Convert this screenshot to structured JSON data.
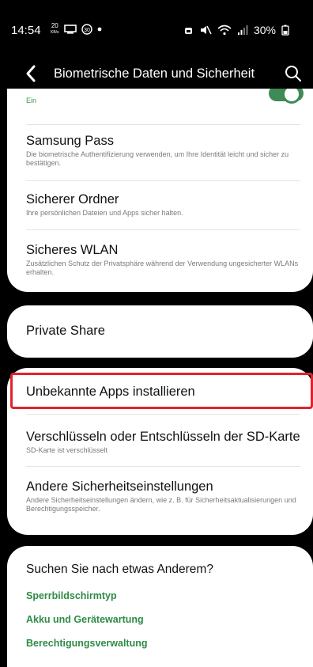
{
  "status_bar": {
    "time": "14:54",
    "speed_value": "20",
    "speed_unit": "KB/s",
    "battery_text": "30%"
  },
  "header": {
    "title": "Biometrische Daten und Sicherheit"
  },
  "card1": {
    "toggle_label": "Ein",
    "toggle_on": true,
    "items": [
      {
        "title": "Samsung Pass",
        "subtitle": "Die biometrische Authentifizierung verwenden, um Ihre Identität leicht und sicher zu bestätigen."
      },
      {
        "title": "Sicherer Ordner",
        "subtitle": "Ihre persönlichen Dateien und Apps sicher halten."
      },
      {
        "title": "Sicheres WLAN",
        "subtitle": "Zusätzlichen Schutz der Privatsphäre während der Verwendung ungesicherter WLANs erhalten."
      }
    ]
  },
  "card2": {
    "title": "Private Share"
  },
  "card3": {
    "items": [
      {
        "title": "Unbekannte Apps installieren"
      },
      {
        "title": "Verschlüsseln oder Entschlüsseln der SD-Karte",
        "subtitle": "SD-Karte ist verschlüsselt"
      },
      {
        "title": "Andere Sicherheitseinstellungen",
        "subtitle": "Andere Sicherheitseinstellungen ändern, wie z. B. für Sicherheitsaktualisierungen und Berechtigungsspeicher."
      }
    ]
  },
  "card4": {
    "title": "Suchen Sie nach etwas Anderem?",
    "links": [
      "Sperrbildschirmtyp",
      "Akku und Gerätewartung",
      "Berechtigungsverwaltung"
    ]
  },
  "colors": {
    "accent_green": "#2e8b46",
    "highlight_red": "#e0232d"
  }
}
